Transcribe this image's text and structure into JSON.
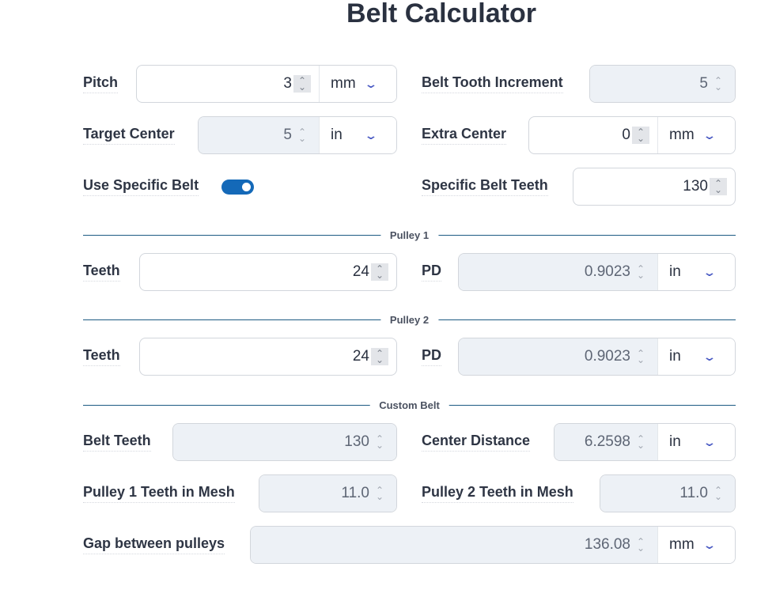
{
  "title": "Belt Calculator",
  "fields": {
    "pitch": {
      "label": "Pitch",
      "value": "3",
      "unit": "mm"
    },
    "belt_tooth_increment": {
      "label": "Belt Tooth Increment",
      "value": "5"
    },
    "target_center": {
      "label": "Target Center",
      "value": "5",
      "unit": "in"
    },
    "extra_center": {
      "label": "Extra Center",
      "value": "0",
      "unit": "mm"
    },
    "use_specific_belt": {
      "label": "Use Specific Belt",
      "checked": true
    },
    "specific_belt_teeth": {
      "label": "Specific Belt Teeth",
      "value": "130"
    },
    "p1_teeth": {
      "label": "Teeth",
      "value": "24"
    },
    "p1_pd": {
      "label": "PD",
      "value": "0.9023",
      "unit": "in"
    },
    "p2_teeth": {
      "label": "Teeth",
      "value": "24"
    },
    "p2_pd": {
      "label": "PD",
      "value": "0.9023",
      "unit": "in"
    },
    "belt_teeth": {
      "label": "Belt Teeth",
      "value": "130"
    },
    "center_distance": {
      "label": "Center Distance",
      "value": "6.2598",
      "unit": "in"
    },
    "p1_mesh": {
      "label": "Pulley 1 Teeth in Mesh",
      "value": "11.0"
    },
    "p2_mesh": {
      "label": "Pulley 2 Teeth in Mesh",
      "value": "11.0"
    },
    "gap": {
      "label": "Gap between pulleys",
      "value": "136.08",
      "unit": "mm"
    }
  },
  "sections": {
    "pulley1": "Pulley 1",
    "pulley2": "Pulley 2",
    "custom_belt": "Custom Belt"
  },
  "colors": {
    "accent": "#1469b8",
    "divider": "#1c5a82",
    "chevron": "#4b5bc4",
    "disabled_bg": "#edf1f6"
  }
}
